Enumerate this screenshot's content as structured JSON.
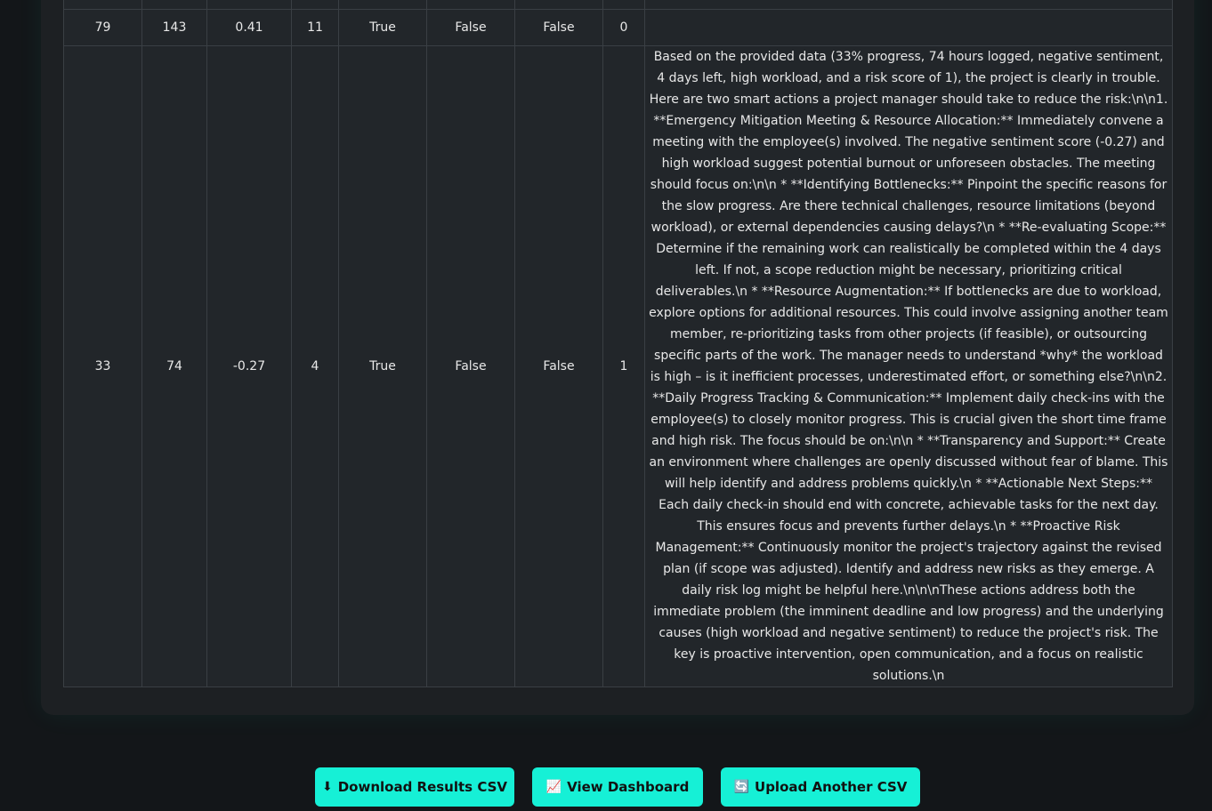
{
  "table": {
    "rows": [
      {
        "c1": "",
        "c2": "",
        "c3": "",
        "c4": "",
        "c5": "",
        "c6": "",
        "c7": "",
        "c8": "",
        "rec": ""
      },
      {
        "c1": "79",
        "c2": "143",
        "c3": "0.41",
        "c4": "11",
        "c5": "True",
        "c6": "False",
        "c7": "False",
        "c8": "0",
        "rec": ""
      },
      {
        "c1": "33",
        "c2": "74",
        "c3": "-0.27",
        "c4": "4",
        "c5": "True",
        "c6": "False",
        "c7": "False",
        "c8": "1",
        "rec": "Based on the provided data (33% progress, 74 hours logged, negative sentiment, 4 days left, high workload, and a risk score of 1), the project is clearly in trouble. Here are two smart actions a project manager should take to reduce the risk:\\n\\n1. **Emergency Mitigation Meeting & Resource Allocation:** Immediately convene a meeting with the employee(s) involved. The negative sentiment score (-0.27) and high workload suggest potential burnout or unforeseen obstacles. The meeting should focus on:\\n\\n * **Identifying Bottlenecks:** Pinpoint the specific reasons for the slow progress. Are there technical challenges, resource limitations (beyond workload), or external dependencies causing delays?\\n * **Re-evaluating Scope:** Determine if the remaining work can realistically be completed within the 4 days left. If not, a scope reduction might be necessary, prioritizing critical deliverables.\\n * **Resource Augmentation:** If bottlenecks are due to workload, explore options for additional resources. This could involve assigning another team member, re-prioritizing tasks from other projects (if feasible), or outsourcing specific parts of the work. The manager needs to understand *why* the workload is high – is it inefficient processes, underestimated effort, or something else?\\n\\n2. **Daily Progress Tracking & Communication:** Implement daily check-ins with the employee(s) to closely monitor progress. This is crucial given the short time frame and high risk. The focus should be on:\\n\\n * **Transparency and Support:** Create an environment where challenges are openly discussed without fear of blame. This will help identify and address problems quickly.\\n * **Actionable Next Steps:** Each daily check-in should end with concrete, achievable tasks for the next day. This ensures focus and prevents further delays.\\n * **Proactive Risk Management:** Continuously monitor the project's trajectory against the revised plan (if scope was adjusted). Identify and address new risks as they emerge. A daily risk log might be helpful here.\\n\\n\\nThese actions address both the immediate problem (the imminent deadline and low progress) and the underlying causes (high workload and negative sentiment) to reduce the project's risk. The key is proactive intervention, open communication, and a focus on realistic solutions.\\n"
      }
    ]
  },
  "actions": {
    "download": {
      "icon": "⬇",
      "label": "Download Results CSV"
    },
    "dashboard": {
      "icon": "📈",
      "label": "View Dashboard"
    },
    "upload": {
      "icon": "🔄",
      "label": "Upload Another CSV"
    }
  },
  "colors": {
    "button_accent": "#16f0d6",
    "page_background": "#131619",
    "card_background": "#1d2023",
    "table_background": "#22262a"
  }
}
